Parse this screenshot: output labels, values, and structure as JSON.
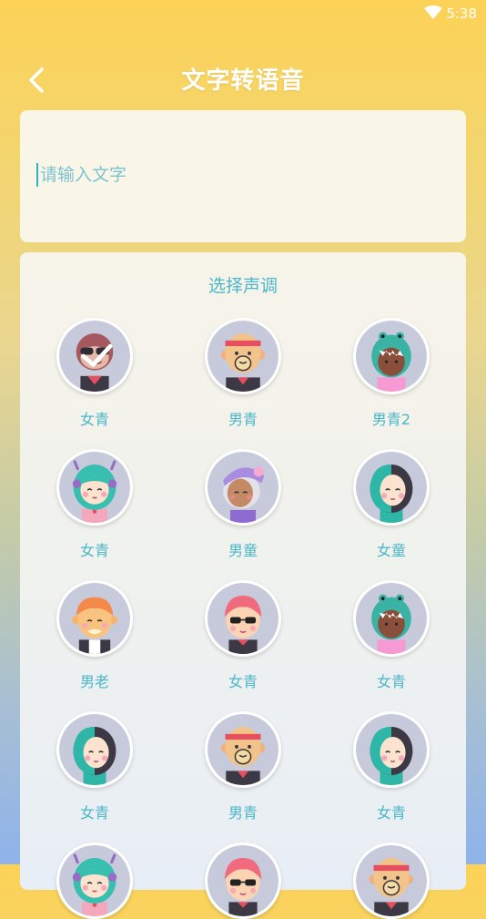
{
  "status": {
    "time": "5:38"
  },
  "header": {
    "title": "文字转语音"
  },
  "input": {
    "placeholder": "请输入文字",
    "value": ""
  },
  "voices_section": {
    "title": "选择声调",
    "items": [
      {
        "label": "女青",
        "avatar": "monkey-sunglasses",
        "selected": true
      },
      {
        "label": "男青",
        "avatar": "bald-headband-man"
      },
      {
        "label": "男青2",
        "avatar": "dino-hood"
      },
      {
        "label": "女青",
        "avatar": "teal-hair-girl"
      },
      {
        "label": "男童",
        "avatar": "purple-beanie-grandma"
      },
      {
        "label": "女童",
        "avatar": "dark-teal-hair-girl"
      },
      {
        "label": "男老",
        "avatar": "orange-hair-man"
      },
      {
        "label": "女青",
        "avatar": "pink-hair-sunglasses"
      },
      {
        "label": "女青",
        "avatar": "dino-hood"
      },
      {
        "label": "女青",
        "avatar": "dark-teal-hair-girl"
      },
      {
        "label": "男青",
        "avatar": "bald-headband-man"
      },
      {
        "label": "女青",
        "avatar": "dark-teal-hair-girl"
      }
    ]
  },
  "colors": {
    "accent": "#4ab6c9",
    "avatar_bg": "#c6cadb"
  }
}
